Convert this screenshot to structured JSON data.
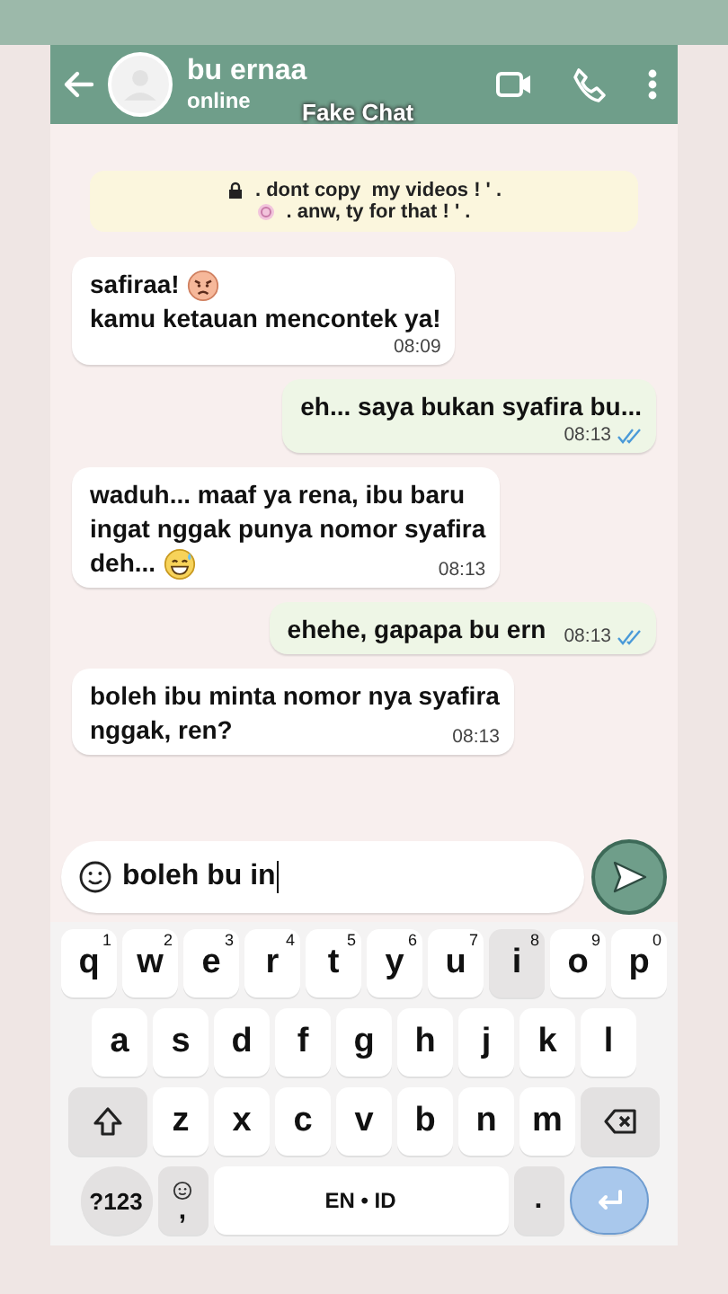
{
  "header": {
    "name": "bu ernaa",
    "status": "online",
    "overlay": "Fake Chat"
  },
  "banner": {
    "lines": [
      ". dont copy  my videos ! ' .",
      ". anw, ty for that ! ' ."
    ]
  },
  "messages": [
    {
      "kind": "incoming",
      "lines": [
        [
          {
            "kind": "text",
            "text": "safiraa!"
          },
          {
            "kind": "angry-face"
          }
        ],
        [
          {
            "kind": "text",
            "text": "kamu ketauan mencontek ya!"
          }
        ]
      ],
      "time": "08:09"
    },
    {
      "kind": "outgoing",
      "lines": [
        [
          {
            "kind": "text",
            "text": "eh... saya bukan syafira bu..."
          }
        ]
      ],
      "time": "08:13",
      "read": true
    },
    {
      "kind": "incoming",
      "lines": [
        [
          {
            "kind": "text",
            "text": "waduh... maaf ya rena, ibu baru"
          }
        ],
        [
          {
            "kind": "text",
            "text": "ingat nggak punya nomor syafira"
          }
        ],
        [
          {
            "kind": "text",
            "text": "deh..."
          },
          {
            "kind": "sweat-smile-face"
          }
        ]
      ],
      "time": "08:13"
    },
    {
      "kind": "outgoing",
      "lines": [
        [
          {
            "kind": "text",
            "text": "ehehe, gapapa bu ern"
          }
        ]
      ],
      "time": "08:13",
      "read": true
    },
    {
      "kind": "incoming",
      "lines": [
        [
          {
            "kind": "text",
            "text": "boleh ibu minta nomor nya syafira"
          }
        ],
        [
          {
            "kind": "text",
            "text": "nggak, ren?"
          }
        ]
      ],
      "time": "08:13"
    }
  ],
  "composer": {
    "value": "boleh bu in"
  },
  "keyboard": {
    "rows": [
      {
        "keys": [
          {
            "kind": "letter",
            "label": "q",
            "hint": "1",
            "selected": false
          },
          {
            "kind": "letter",
            "label": "w",
            "hint": "2",
            "selected": false
          },
          {
            "kind": "letter",
            "label": "e",
            "hint": "3",
            "selected": false
          },
          {
            "kind": "letter",
            "label": "r",
            "hint": "4",
            "selected": false
          },
          {
            "kind": "letter",
            "label": "t",
            "hint": "5",
            "selected": false
          },
          {
            "kind": "letter",
            "label": "y",
            "hint": "6",
            "selected": false
          },
          {
            "kind": "letter",
            "label": "u",
            "hint": "7",
            "selected": false
          },
          {
            "kind": "letter",
            "label": "i",
            "hint": "8",
            "selected": true
          },
          {
            "kind": "letter",
            "label": "o",
            "hint": "9",
            "selected": false
          },
          {
            "kind": "letter",
            "label": "p",
            "hint": "0",
            "selected": false
          }
        ]
      },
      {
        "keys": [
          {
            "kind": "letter",
            "label": "a",
            "selected": false
          },
          {
            "kind": "letter",
            "label": "s",
            "selected": false
          },
          {
            "kind": "letter",
            "label": "d",
            "selected": false
          },
          {
            "kind": "letter",
            "label": "f",
            "selected": false
          },
          {
            "kind": "letter",
            "label": "g",
            "selected": false
          },
          {
            "kind": "letter",
            "label": "h",
            "selected": false
          },
          {
            "kind": "letter",
            "label": "j",
            "selected": false
          },
          {
            "kind": "letter",
            "label": "k",
            "selected": false
          },
          {
            "kind": "letter",
            "label": "l",
            "selected": false
          }
        ]
      },
      {
        "keys": [
          {
            "kind": "shift"
          },
          {
            "kind": "letter",
            "label": "z",
            "selected": false
          },
          {
            "kind": "letter",
            "label": "x",
            "selected": false
          },
          {
            "kind": "letter",
            "label": "c",
            "selected": false
          },
          {
            "kind": "letter",
            "label": "v",
            "selected": false
          },
          {
            "kind": "letter",
            "label": "b",
            "selected": false
          },
          {
            "kind": "letter",
            "label": "n",
            "selected": false
          },
          {
            "kind": "letter",
            "label": "m",
            "selected": false
          },
          {
            "kind": "backspace"
          }
        ]
      },
      {
        "keys": [
          {
            "kind": "symbols",
            "label": "?123"
          },
          {
            "kind": "comma",
            "label": ","
          },
          {
            "kind": "space",
            "label": "EN • ID"
          },
          {
            "kind": "period",
            "label": "."
          },
          {
            "kind": "enter"
          }
        ]
      }
    ]
  }
}
